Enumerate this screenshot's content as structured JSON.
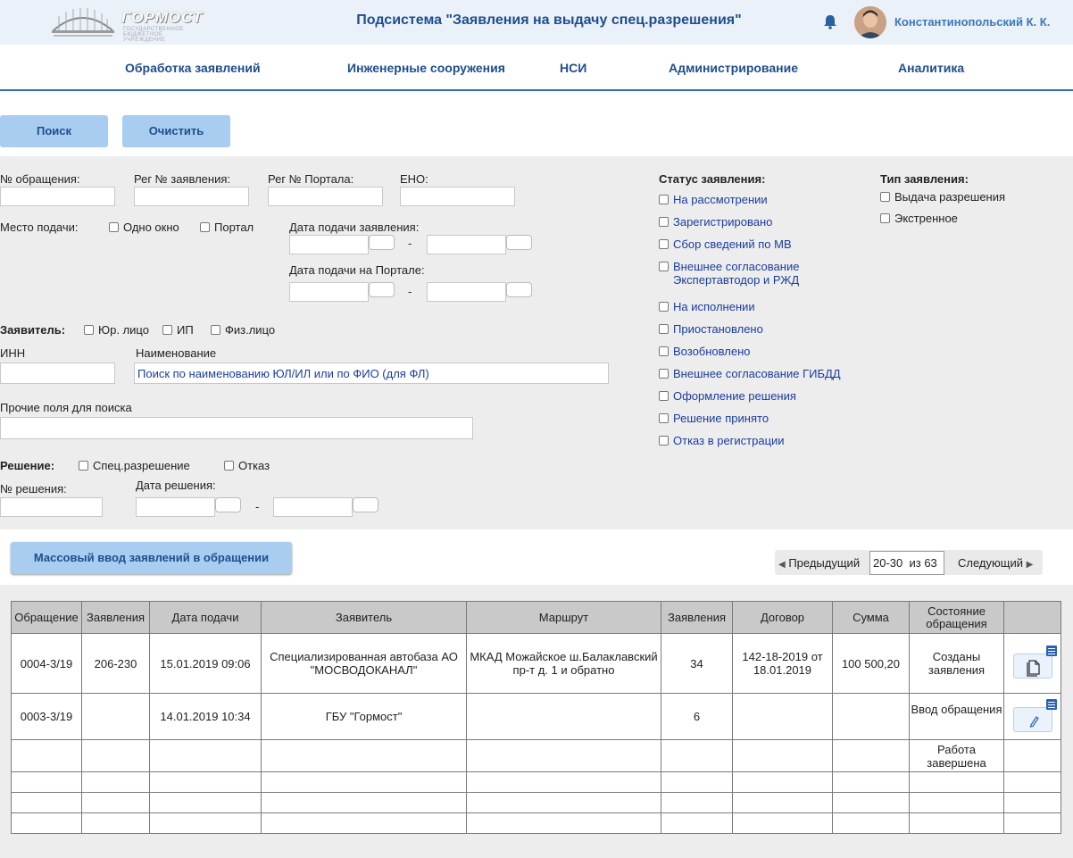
{
  "header": {
    "logo_text": "ГОРМОСТ",
    "logo_sub": "ГОСУДАРСТВЕННОЕ БЮДЖЕТНОЕ УЧРЕЖДЕНИЕ",
    "title": "Подсистема \"Заявления на выдачу спец.разрешения\"",
    "username": "Константинопольский К. К."
  },
  "nav": [
    "Обработка заявлений",
    "Инженерные сооружения",
    "НСИ",
    "Администрирование",
    "Аналитика"
  ],
  "actions": {
    "search": "Поиск",
    "clear": "Очистить"
  },
  "filters": {
    "appeal_no": "№ обращения:",
    "reg_app_no": "Рег № заявления:",
    "reg_portal_no": "Рег № Портала:",
    "eno": "ЕНО:",
    "place": "Место подачи:",
    "one_window": "Одно окно",
    "portal": "Портал",
    "app_date": "Дата подачи заявления:",
    "portal_date": "Дата подачи на Портале:",
    "dash": "-",
    "applicant": "Заявитель:",
    "legal": "Юр. лицо",
    "ip": "ИП",
    "individual": "Физ.лицо",
    "inn": "ИНН",
    "name": "Наименование",
    "name_placeholder": "Поиск по наименованию ЮЛ/ИЛ или по ФИО (для ФЛ)",
    "other": "Прочие поля для поиска",
    "decision": "Решение:",
    "spec_permit": "Спец.разрешение",
    "refusal": "Отказ",
    "decision_no": "№ решения:",
    "decision_date": "Дата решения:"
  },
  "status": {
    "title": "Статус заявления:",
    "items": [
      "На рассмотрении",
      "Зарегистрировано",
      "Сбор сведений по МВ",
      "Внешнее согласование",
      "Экспертавтодор и РЖД",
      "На исполнении",
      "Приостановлено",
      "Возобновлено",
      "Внешнее согласование ГИБДД",
      "Оформление решения",
      "Решение принято",
      "Отказ в регистрации"
    ]
  },
  "type": {
    "title": "Тип заявления:",
    "items": [
      "Выдача разрешения",
      "Экстренное"
    ]
  },
  "mass_input": "Массовый ввод заявлений в обращении",
  "pager": {
    "prev": "Предыдущий",
    "range": "20-30",
    "of": "из 63",
    "next": "Следующий"
  },
  "table": {
    "headers": [
      "Обращение",
      "Заявления",
      "Дата подачи",
      "Заявитель",
      "Маршрут",
      "Заявления",
      "Договор",
      "Сумма",
      "Состояние обращения",
      ""
    ],
    "rows": [
      [
        "0004-3/19",
        "206-230",
        "15.01.2019 09:06",
        "Специализированная автобаза АО \"МОСВОДОКАНАЛ\"",
        "МКАД Можайское ш.Балаклавский пр-т д. 1 и обратно",
        "34",
        "142-18-2019 от 18.01.2019",
        "100 500,20",
        "Созданы заявления"
      ],
      [
        "0003-3/19",
        "",
        "14.01.2019 10:34",
        "ГБУ \"Гормост\"",
        "",
        "6",
        "",
        "",
        "Ввод обращения"
      ],
      [
        "",
        "",
        "",
        "",
        "",
        "",
        "",
        "",
        "Работа завершена"
      ],
      [
        "",
        "",
        "",
        "",
        "",
        "",
        "",
        "",
        ""
      ],
      [
        "",
        "",
        "",
        "",
        "",
        "",
        "",
        "",
        ""
      ],
      [
        "",
        "",
        "",
        "",
        "",
        "",
        "",
        "",
        ""
      ]
    ]
  }
}
